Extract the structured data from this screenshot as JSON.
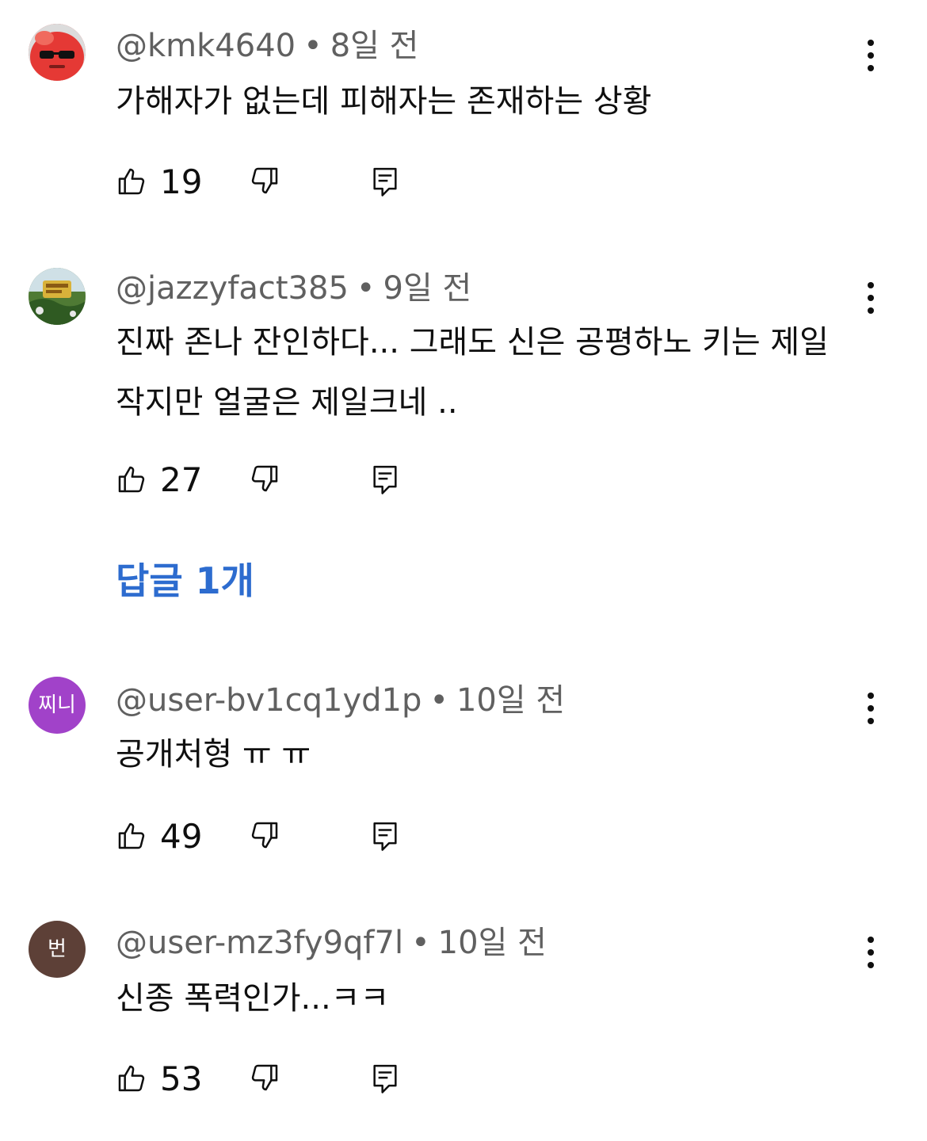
{
  "comments": [
    {
      "username": "@kmk4640",
      "time": "8일 전",
      "text": "가해자가 없는데 피해자는 존재하는 상황",
      "likes": "19",
      "avatar": {
        "type": "image",
        "icon": "red-creature-with-sunglasses",
        "bg": "#e53935"
      }
    },
    {
      "username": "@jazzyfact385",
      "time": "9일 전",
      "text": "진짜 존나 잔인하다... 그래도 신은 공평하노 키는 제일 작지만 얼굴은 제일크네 ..",
      "likes": "27",
      "avatar": {
        "type": "image",
        "icon": "jazzy-landscape-logo",
        "bg": "#4f6a3a"
      }
    },
    {
      "username": "@user-bv1cq1yd1p",
      "time": "10일 전",
      "text": "공개처형 ㅠ ㅠ",
      "likes": "49",
      "avatar": {
        "type": "letter",
        "letter": "찌니",
        "bg": "#a142c9"
      }
    },
    {
      "username": "@user-mz3fy9qf7l",
      "time": "10일 전",
      "text": "신종 폭력인가...ㅋㅋ",
      "likes": "53",
      "avatar": {
        "type": "letter",
        "letter": "번",
        "bg": "#5d4037"
      }
    }
  ],
  "replies_link": "답글 1개",
  "separator": "•",
  "icons": {
    "like": "thumb-up-icon",
    "dislike": "thumb-down-icon",
    "reply": "reply-comment-icon",
    "more": "more-vertical-icon"
  },
  "colors": {
    "link": "#2d6ccf",
    "meta": "#606060",
    "text": "#0f0f0f"
  }
}
